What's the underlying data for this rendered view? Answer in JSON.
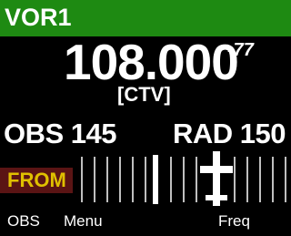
{
  "title": "VOR1",
  "frequency": {
    "value": "108.000",
    "signal": "-77",
    "station": "[CTV]"
  },
  "readouts": {
    "obs": "OBS 145",
    "rad": "RAD 150"
  },
  "cdi": {
    "to_from": "FROM",
    "to_from_color": "#e0c000",
    "to_from_bg": "#5a1414",
    "aircraft_icon": "airplane-icon"
  },
  "softkeys": {
    "obs": "OBS",
    "menu": "Menu",
    "freq": "Freq"
  },
  "colors": {
    "title_bar": "#1e8a12",
    "background": "#000000",
    "text": "#ffffff"
  }
}
